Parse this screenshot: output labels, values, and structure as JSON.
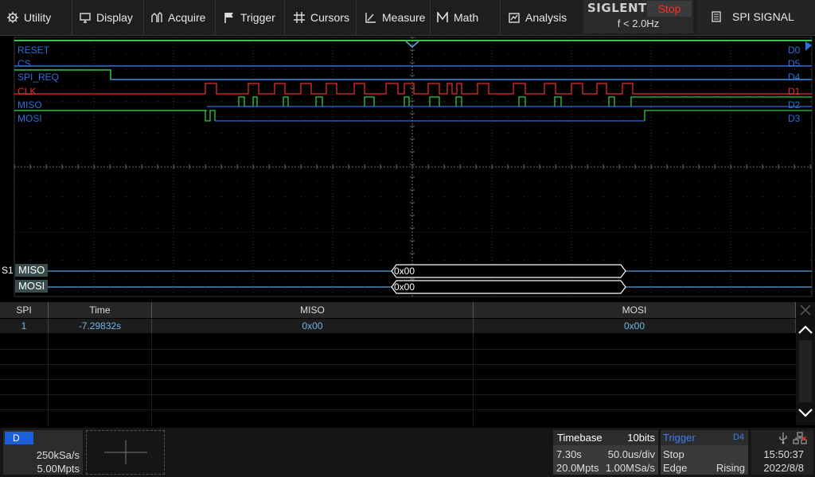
{
  "menu": {
    "items": [
      {
        "label": "Utility",
        "icon": "gear-icon"
      },
      {
        "label": "Display",
        "icon": "monitor-icon"
      },
      {
        "label": "Acquire",
        "icon": "acquire-icon"
      },
      {
        "label": "Trigger",
        "icon": "flag-icon"
      },
      {
        "label": "Cursors",
        "icon": "cursor-grid-icon"
      },
      {
        "label": "Measure",
        "icon": "measure-icon"
      },
      {
        "label": "Math",
        "icon": "math-icon"
      },
      {
        "label": "Analysis",
        "icon": "analysis-icon"
      }
    ],
    "logo": "SIGLENT",
    "run_state": "Stop",
    "trigger_freq": "f < 2.0Hz",
    "app_title": "SPI SIGNAL"
  },
  "channels": [
    {
      "name": "RESET",
      "id": "D0",
      "color": "#2f6fd8"
    },
    {
      "name": "CS",
      "id": "D5",
      "color": "#2f6fd8"
    },
    {
      "name": "SPI_REQ",
      "id": "D4",
      "color": "#2f6fd8"
    },
    {
      "name": "CLK",
      "id": "D1",
      "color": "#e03030"
    },
    {
      "name": "MISO",
      "id": "D2",
      "color": "#2f6fd8"
    },
    {
      "name": "MOSI",
      "id": "D3",
      "color": "#2f6fd8"
    }
  ],
  "decode": {
    "bus": "S1",
    "lines": [
      {
        "label": "MISO",
        "value": "0x00"
      },
      {
        "label": "MOSI",
        "value": "0x00"
      }
    ]
  },
  "table": {
    "headers": [
      "SPI",
      "Time",
      "MISO",
      "MOSI"
    ],
    "rows": [
      [
        "1",
        "-7.29832s",
        "0x00",
        "0x00"
      ]
    ]
  },
  "bottom": {
    "digital_badge": "D",
    "sample_rate": "250kSa/s",
    "memory_depth": "5.00Mpts",
    "timebase": {
      "title": "Timebase",
      "bits": "10bits",
      "delay": "7.30s",
      "scale": "50.0us/div",
      "mpts": "20.0Mpts",
      "rate": "1.00MSa/s"
    },
    "trigger": {
      "title": "Trigger",
      "source": "D4",
      "mode": "Stop",
      "type": "Edge",
      "slope": "Rising"
    },
    "time": "15:50:37",
    "date": "2022/8/8"
  }
}
